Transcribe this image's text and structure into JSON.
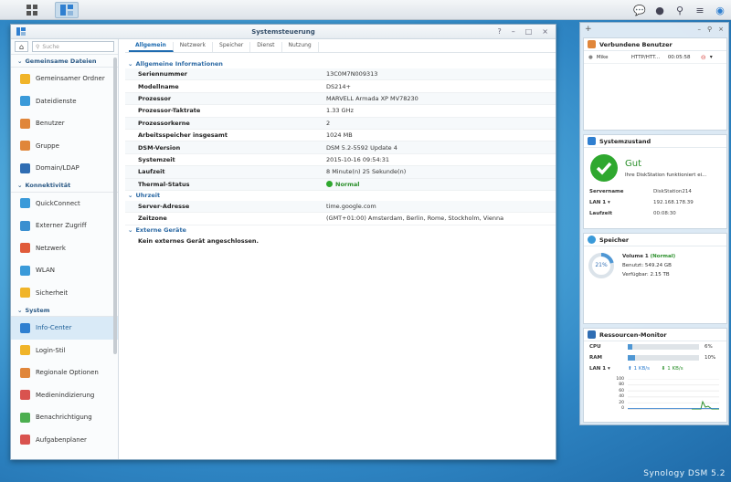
{
  "window": {
    "title": "Systemsteuerung",
    "controls": [
      "?",
      "–",
      "□",
      "×"
    ]
  },
  "sidebar": {
    "search_placeholder": "Suche",
    "sections": [
      {
        "label": "Gemeinsame Dateien",
        "items": [
          {
            "label": "Gemeinsamer Ordner",
            "icon": "folder-icon",
            "color": "#f0b429"
          },
          {
            "label": "Dateidienste",
            "icon": "file-services-icon",
            "color": "#3a9ad9"
          },
          {
            "label": "Benutzer",
            "icon": "user-icon",
            "color": "#e0863a"
          },
          {
            "label": "Gruppe",
            "icon": "group-icon",
            "color": "#e0863a"
          },
          {
            "label": "Domain/LDAP",
            "icon": "domain-icon",
            "color": "#2f6db3"
          }
        ]
      },
      {
        "label": "Konnektivität",
        "items": [
          {
            "label": "QuickConnect",
            "icon": "quickconnect-icon",
            "color": "#3a9ad9"
          },
          {
            "label": "Externer Zugriff",
            "icon": "external-access-icon",
            "color": "#3a8fd0"
          },
          {
            "label": "Netzwerk",
            "icon": "network-icon",
            "color": "#e05b3a"
          },
          {
            "label": "WLAN",
            "icon": "wifi-icon",
            "color": "#3a9ad9"
          },
          {
            "label": "Sicherheit",
            "icon": "shield-icon",
            "color": "#f0b429"
          }
        ]
      },
      {
        "label": "System",
        "items": [
          {
            "label": "Info-Center",
            "icon": "info-icon",
            "color": "#2f7fd0",
            "selected": true
          },
          {
            "label": "Login-Stil",
            "icon": "login-style-icon",
            "color": "#f0b429"
          },
          {
            "label": "Regionale Optionen",
            "icon": "region-icon",
            "color": "#e0863a"
          },
          {
            "label": "Medienindizierung",
            "icon": "media-icon",
            "color": "#d9534f"
          },
          {
            "label": "Benachrichtigung",
            "icon": "notification-icon",
            "color": "#4caf50"
          },
          {
            "label": "Aufgabenplaner",
            "icon": "task-scheduler-icon",
            "color": "#d9534f"
          }
        ]
      }
    ]
  },
  "tabs": [
    "Allgemein",
    "Netzwerk",
    "Speicher",
    "Dienst",
    "Nutzung"
  ],
  "general": {
    "section_title": "Allgemeine Informationen",
    "rows": [
      {
        "k": "Seriennummer",
        "v": "13C0M7N009313"
      },
      {
        "k": "Modellname",
        "v": "DS214+"
      },
      {
        "k": "Prozessor",
        "v": "MARVELL Armada XP MV78230"
      },
      {
        "k": "Prozessor-Taktrate",
        "v": "1.33 GHz"
      },
      {
        "k": "Prozessorkerne",
        "v": "2"
      },
      {
        "k": "Arbeitsspeicher insgesamt",
        "v": "1024 MB"
      },
      {
        "k": "DSM-Version",
        "v": "DSM 5.2-5592 Update 4"
      },
      {
        "k": "Systemzeit",
        "v": "2015-10-16 09:54:31"
      },
      {
        "k": "Laufzeit",
        "v": "8 Minute(n) 25 Sekunde(n)"
      }
    ],
    "thermal_label": "Thermal-Status",
    "thermal_value": "Normal"
  },
  "time": {
    "section_title": "Uhrzeit",
    "rows": [
      {
        "k": "Server-Adresse",
        "v": "time.google.com"
      },
      {
        "k": "Zeitzone",
        "v": "(GMT+01:00) Amsterdam, Berlin, Rome, Stockholm, Vienna"
      }
    ]
  },
  "external": {
    "section_title": "Externe Geräte",
    "message": "Kein externes Gerät angeschlossen."
  },
  "widgets": {
    "add": "+",
    "connected_users": {
      "title": "Verbundene Benutzer",
      "user": "Mike",
      "protocol": "HTTP/HTT...",
      "time": "00:05:58"
    },
    "health": {
      "title": "Systemzustand",
      "status": "Gut",
      "message": "Ihre DiskStation funktioniert ei...",
      "rows": [
        {
          "k": "Servername",
          "v": "DiskStation214"
        },
        {
          "k": "LAN 1 ▾",
          "v": "192.168.178.39"
        },
        {
          "k": "Laufzeit",
          "v": "00:08:30"
        }
      ]
    },
    "storage": {
      "title": "Speicher",
      "percent": "21%",
      "volume": "Volume 1",
      "volume_status": "(Normal)",
      "used": "Benutzt: 549.24 GB",
      "free": "Verfügbar: 2.15 TB"
    },
    "resource": {
      "title": "Ressourcen-Monitor",
      "cpu_label": "CPU",
      "cpu_value": "6%",
      "cpu_fraction": 0.06,
      "ram_label": "RAM",
      "ram_value": "10%",
      "ram_fraction": 0.1,
      "lan_label": "LAN 1 ▾",
      "up": "1 KB/s",
      "down": "1 KB/s",
      "y_ticks": [
        "100",
        "80",
        "60",
        "40",
        "20",
        "0"
      ]
    }
  },
  "brand": "Synology DSM 5.2"
}
